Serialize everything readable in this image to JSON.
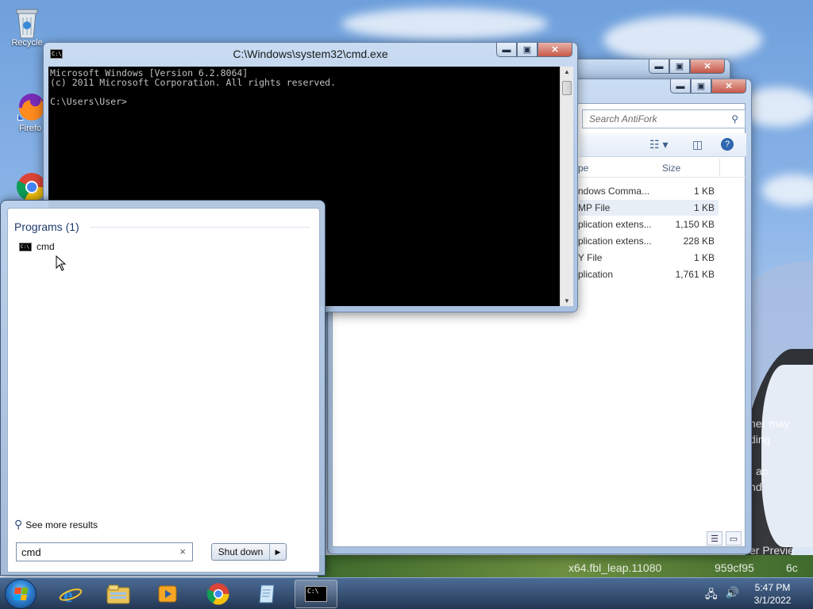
{
  "desktop": {
    "icons": [
      {
        "label": "Recycle",
        "icon": "recycle-bin-icon"
      },
      {
        "label": "Firefo",
        "icon": "firefox-icon"
      },
      {
        "label": "",
        "icon": "chrome-icon"
      }
    ],
    "watermark": [
      "ner may",
      "ding",
      "ac",
      "nd",
      "er Previe",
      "x64.fbl_leap.11080",
      "959cf95",
      "6c"
    ]
  },
  "explorer": {
    "search_placeholder": "Search AntiFork",
    "columns": {
      "type": "pe",
      "size": "Size"
    },
    "rows": [
      {
        "type": "ndows Comma...",
        "size": "1 KB",
        "selected": false
      },
      {
        "type": "MP File",
        "size": "1 KB",
        "selected": true
      },
      {
        "type": "plication extens...",
        "size": "1,150 KB",
        "selected": false
      },
      {
        "type": "plication extens...",
        "size": "228 KB",
        "selected": false
      },
      {
        "type": "Y File",
        "size": "1 KB",
        "selected": false
      },
      {
        "type": "plication",
        "size": "1,761 KB",
        "selected": false
      }
    ]
  },
  "cmd": {
    "title": "C:\\Windows\\system32\\cmd.exe",
    "icon_text": "C:\\",
    "lines": "Microsoft Windows [Version 6.2.8064]\n(c) 2011 Microsoft Corporation. All rights reserved.\n\nC:\\Users\\User>"
  },
  "start_menu": {
    "programs_header": "Programs (1)",
    "programs": [
      {
        "label": "cmd",
        "icon": "cmd-icon"
      }
    ],
    "see_more": "See more results",
    "search_value": "cmd",
    "search_clear": "×",
    "shutdown_label": "Shut down",
    "shutdown_arrow": "▶"
  },
  "window_controls": {
    "minimize": "▬",
    "maximize": "▣",
    "close": "✕"
  },
  "taskbar": {
    "pinned": [
      "internet-explorer-icon",
      "file-explorer-icon",
      "media-player-icon",
      "chrome-icon",
      "notepad-icon",
      "cmd-icon"
    ],
    "cmd_icon_text": "C:\\",
    "clock_time": "5:47 PM",
    "clock_date": "3/1/2022"
  },
  "colors": {
    "accent": "#2d7fd0",
    "cmd_bg": "#000000",
    "cmd_text": "#c0c0c0"
  }
}
